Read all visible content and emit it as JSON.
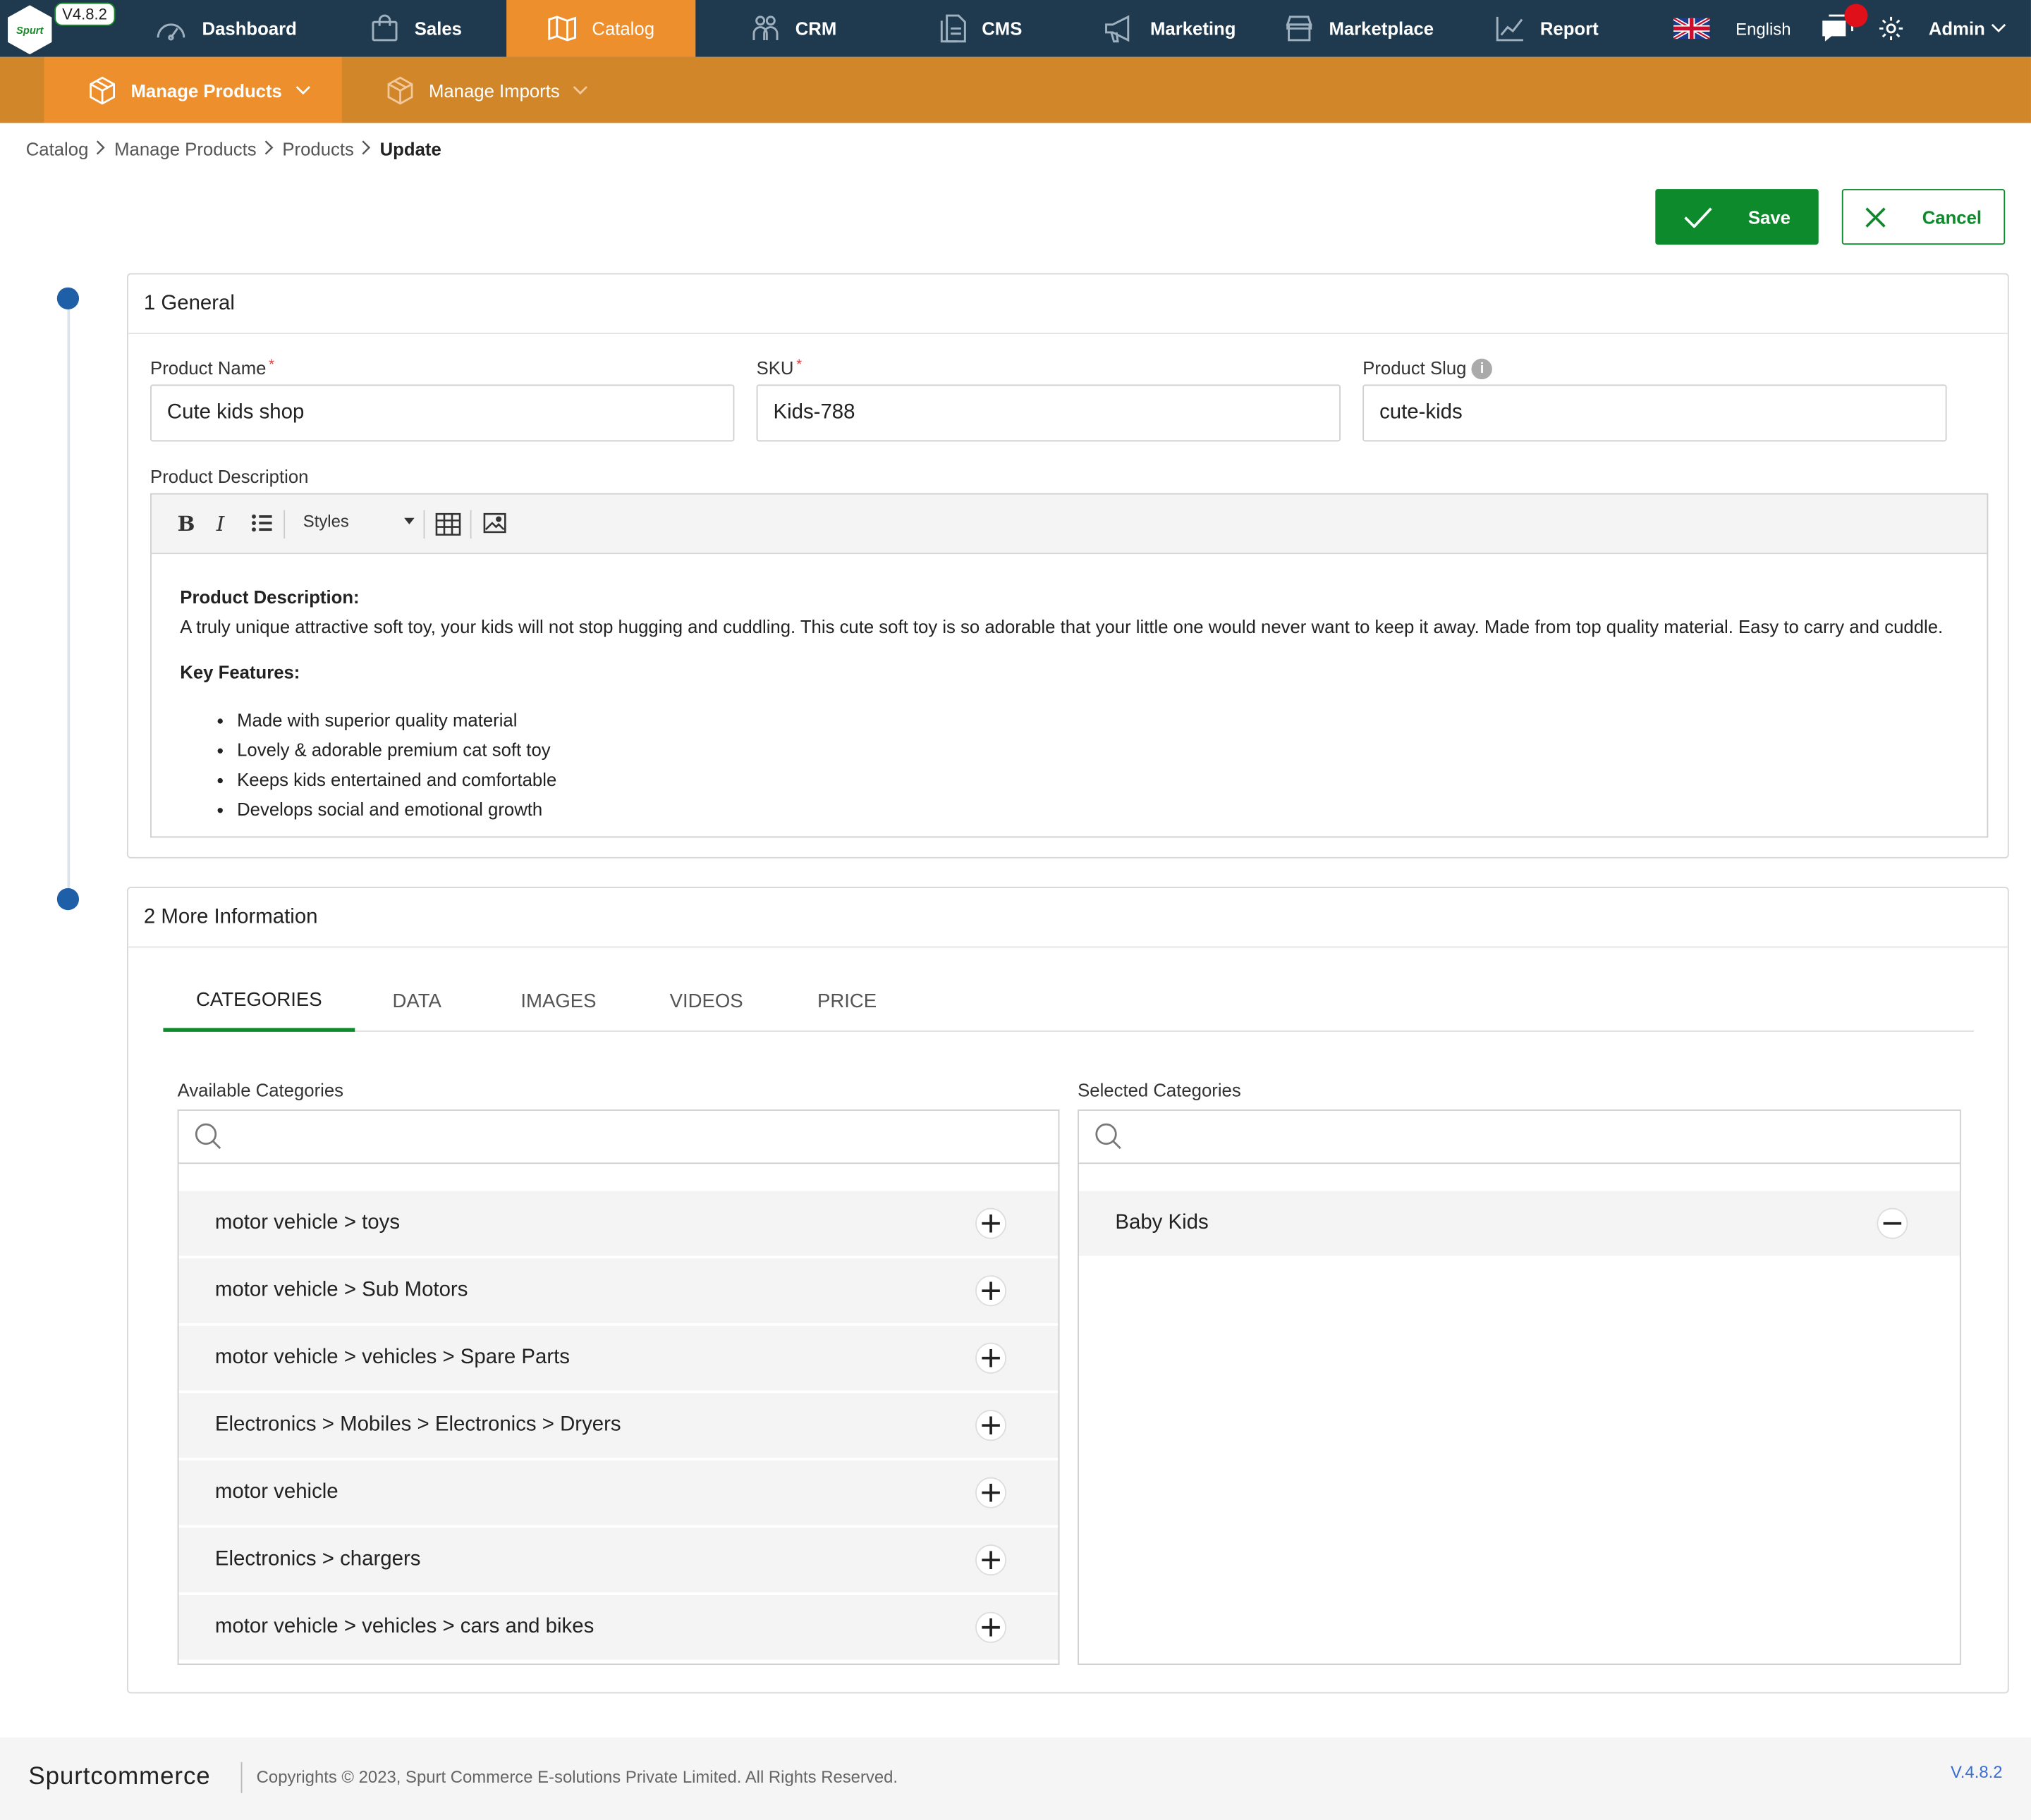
{
  "app": {
    "version_badge": "V4.8.2",
    "logo_text": "Spurt"
  },
  "topnav": {
    "items": [
      {
        "label": "Dashboard",
        "icon": "gauge-icon"
      },
      {
        "label": "Sales",
        "icon": "shopping-bag-icon"
      },
      {
        "label": "Catalog",
        "icon": "map-icon",
        "active": true
      },
      {
        "label": "CRM",
        "icon": "users-icon"
      },
      {
        "label": "CMS",
        "icon": "document-icon"
      },
      {
        "label": "Marketing",
        "icon": "megaphone-icon"
      },
      {
        "label": "Marketplace",
        "icon": "store-icon"
      },
      {
        "label": "Report",
        "icon": "chart-line-icon"
      }
    ],
    "language": "English",
    "user": "Admin",
    "accent_color": "#ee8f2e",
    "bar_color": "#1f3a4f"
  },
  "subnav": {
    "items": [
      {
        "label": "Manage Products",
        "icon": "box-icon",
        "active": true
      },
      {
        "label": "Manage Imports",
        "icon": "box-icon"
      }
    ]
  },
  "breadcrumb": {
    "items": [
      "Catalog",
      "Manage Products",
      "Products"
    ],
    "current": "Update"
  },
  "actions": {
    "save_label": "Save",
    "cancel_label": "Cancel",
    "save_color": "#0d8a2b"
  },
  "general": {
    "title": "1 General",
    "product_name_label": "Product Name",
    "product_name_value": "Cute kids shop",
    "sku_label": "SKU",
    "sku_value": "Kids-788",
    "slug_label": "Product Slug",
    "slug_value": "cute-kids",
    "description_label": "Product Description",
    "editor": {
      "styles_label": "Styles",
      "heading": "Product Description:",
      "paragraph": "A truly unique attractive soft toy, your kids will not stop hugging and cuddling. This cute soft toy is so adorable that your little one would never want to keep it away. Made from top quality material. Easy to carry and cuddle.",
      "features_heading": "Key Features:",
      "features": [
        "Made with superior quality material",
        "Lovely & adorable premium cat soft toy",
        "Keeps kids entertained and comfortable",
        "Develops social and emotional growth"
      ]
    }
  },
  "more_info": {
    "title": "2 More Information",
    "tabs": [
      "CATEGORIES",
      "DATA",
      "IMAGES",
      "VIDEOS",
      "PRICE"
    ],
    "active_tab": "CATEGORIES",
    "available_label": "Available Categories",
    "selected_label": "Selected Categories",
    "available": [
      "motor vehicle > toys",
      "motor vehicle > Sub Motors",
      "motor vehicle > vehicles > Spare Parts",
      "Electronics > Mobiles > Electronics > Dryers",
      "motor vehicle",
      "Electronics > chargers",
      "motor vehicle > vehicles > cars and bikes"
    ],
    "selected": [
      "Baby Kids"
    ]
  },
  "footer": {
    "brand": "Spurtcommerce",
    "copyright": "Copyrights © 2023, Spurt Commerce E-solutions Private Limited. All Rights Reserved.",
    "version": "V.4.8.2"
  }
}
